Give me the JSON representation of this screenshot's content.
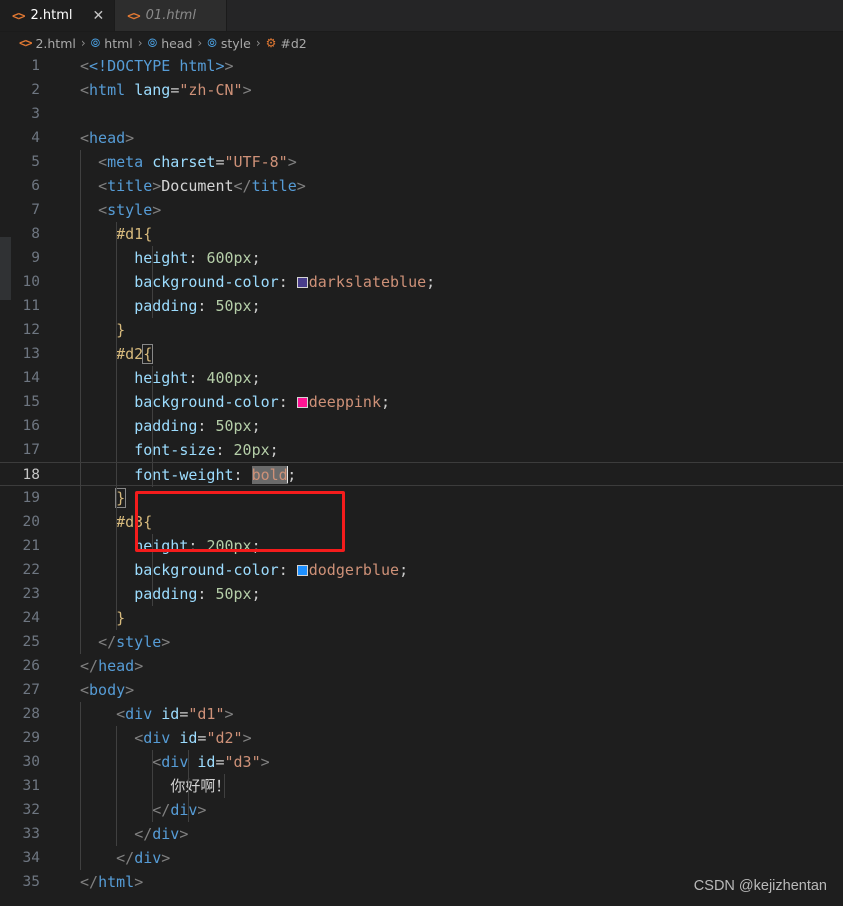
{
  "tabs": [
    {
      "label": "2.html",
      "icon": "html-file-icon",
      "active": true,
      "close_glyph": "✕"
    },
    {
      "label": "01.html",
      "icon": "html-file-icon",
      "active": false
    }
  ],
  "breadcrumb": {
    "separator": "›",
    "items": [
      {
        "label": "2.html",
        "icon": "html-file-icon"
      },
      {
        "label": "html",
        "icon": "cube-icon"
      },
      {
        "label": "head",
        "icon": "cube-icon"
      },
      {
        "label": "style",
        "icon": "cube-icon"
      },
      {
        "label": "#d2",
        "icon": "css-selector-icon"
      }
    ]
  },
  "editor": {
    "language": "html",
    "current_line": 18,
    "selection_text": "bold",
    "line_numbers": [
      "1",
      "2",
      "3",
      "4",
      "5",
      "6",
      "7",
      "8",
      "9",
      "10",
      "11",
      "12",
      "13",
      "14",
      "15",
      "16",
      "17",
      "18",
      "19",
      "20",
      "21",
      "22",
      "23",
      "24",
      "25",
      "26",
      "27",
      "28",
      "29",
      "30",
      "31",
      "32",
      "33",
      "34",
      "35"
    ],
    "lines": [
      "<!DOCTYPE html>",
      "<html lang=\"zh-CN\">",
      "",
      "<head>",
      "  <meta charset=\"UTF-8\">",
      "  <title>Document</title>",
      "  <style>",
      "    #d1{",
      "      height: 600px;",
      "      background-color: darkslateblue;",
      "      padding: 50px;",
      "    }",
      "    #d2{",
      "      height: 400px;",
      "      background-color: deeppink;",
      "      padding: 50px;",
      "      font-size: 20px;",
      "      font-weight: bold;",
      "    }",
      "    #d3{",
      "      height: 200px;",
      "      background-color: dodgerblue;",
      "      padding: 50px;",
      "    }",
      "  </style>",
      "</head>",
      "<body>",
      "    <div id=\"d1\">",
      "      <div id=\"d2\">",
      "        <div id=\"d3\">",
      "          你好啊！",
      "        </div>",
      "      </div>",
      "    </div>",
      "</html>"
    ],
    "color_swatches": [
      {
        "line": 10,
        "name": "darkslateblue",
        "hex": "#483d8b"
      },
      {
        "line": 15,
        "name": "deeppink",
        "hex": "#ff1493"
      },
      {
        "line": 22,
        "name": "dodgerblue",
        "hex": "#1e90ff"
      }
    ],
    "tokens": {
      "doctype": "<!DOCTYPE html>",
      "html_open_tag": "html",
      "lang_attr": "lang",
      "lang_value": "\"zh-CN\"",
      "head_tag": "head",
      "meta_tag": "meta",
      "charset_attr": "charset",
      "charset_value": "\"UTF-8\"",
      "title_tag": "title",
      "title_text": "Document",
      "style_tag": "style",
      "sel_d1": "#d1",
      "sel_d2": "#d2",
      "sel_d3": "#d3",
      "prop_height": "height",
      "prop_background_color": "background-color",
      "prop_padding": "padding",
      "prop_font_size": "font-size",
      "prop_font_weight": "font-weight",
      "val_600px": "600px",
      "val_400px": "400px",
      "val_200px": "200px",
      "val_50px": "50px",
      "val_20px": "20px",
      "val_bold": "bold",
      "val_darkslateblue": "darkslateblue",
      "val_deeppink": "deeppink",
      "val_dodgerblue": "dodgerblue",
      "body_tag": "body",
      "div_tag": "div",
      "id_attr": "id",
      "id_d1": "\"d1\"",
      "id_d2": "\"d2\"",
      "id_d3": "\"d3\"",
      "chinese_text": "你好啊！"
    }
  },
  "annotation": {
    "type": "rectangle-highlight",
    "color": "#f41c1c",
    "covers_lines": [
      17,
      18
    ]
  },
  "watermark": {
    "text": "CSDN @kejizhentan"
  },
  "theme": {
    "editor_background": "#1e1e1e",
    "tab_bar_background": "#252526",
    "active_tab_background": "#1e1e1e",
    "inactive_tab_background": "#2d2d2d",
    "line_number_color": "#6e7681",
    "accent_icon_color": "#e37933"
  }
}
